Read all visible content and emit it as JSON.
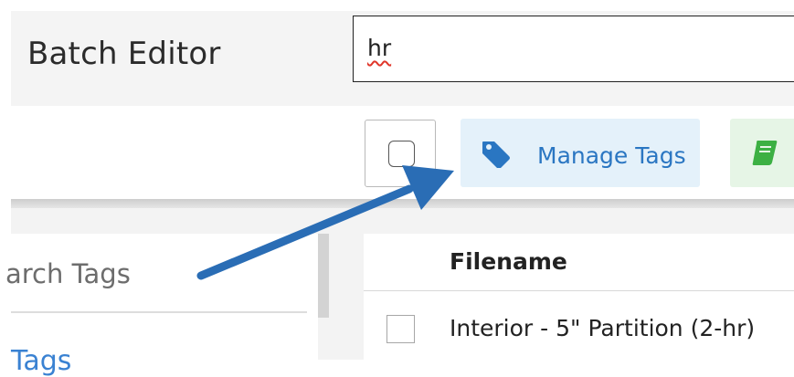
{
  "header": {
    "title": "Batch Editor",
    "search_value": "hr"
  },
  "toolbar": {
    "manage_tags_label": "Manage Tags",
    "tag_icon": "tag-icon",
    "book_icon": "book-icon"
  },
  "sidebar": {
    "search_tags_text": "arch Tags",
    "tags_link_text": "Tags"
  },
  "table": {
    "column_header": "Filename",
    "rows": [
      {
        "filename": "Interior - 5\" Partition (2-hr)"
      }
    ]
  },
  "colors": {
    "accent_blue": "#2a76c2",
    "annotation_arrow": "#2a6db5",
    "manage_tags_bg": "#e4f1fa",
    "green_button_bg": "#e6f5e6",
    "book_icon": "#3cb043"
  }
}
